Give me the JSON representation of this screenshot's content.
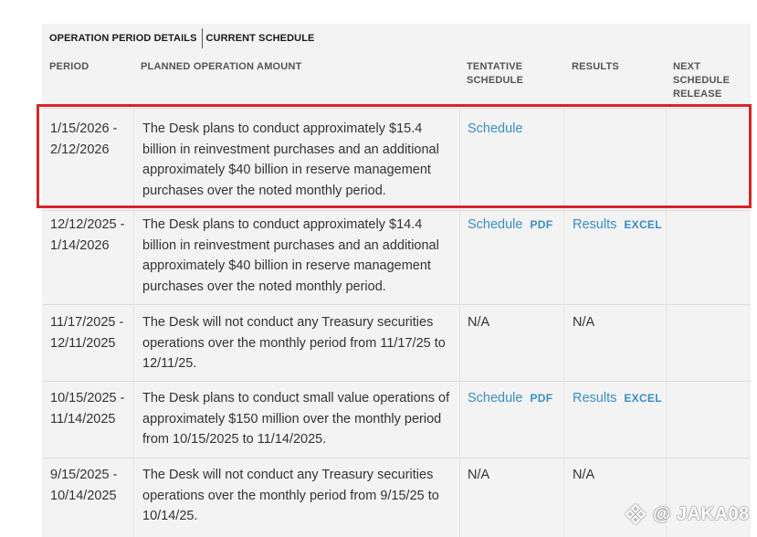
{
  "tabs": [
    {
      "label": "OPERATION PERIOD DETAILS",
      "active": true
    },
    {
      "label": "CURRENT SCHEDULE",
      "active": false
    }
  ],
  "headers": {
    "period": "PERIOD",
    "amount": "PLANNED OPERATION AMOUNT",
    "tentative_line1": "TENTATIVE",
    "tentative_line2": "SCHEDULE",
    "results": "RESULTS",
    "next_line1": "NEXT",
    "next_line2": "SCHEDULE",
    "next_line3": "RELEASE"
  },
  "rows": [
    {
      "period_start": "1/15/2026 -",
      "period_end": "2/12/2026",
      "amount": "The Desk plans to conduct approximately $15.4 billion in reinvestment purchases and an additional approximately $40 billion in reserve management purchases over the noted monthly period.",
      "schedule": "Schedule",
      "schedule_pdf": "",
      "results": "",
      "results_excel": "",
      "next": "",
      "highlighted": true
    },
    {
      "period_start": "12/12/2025 -",
      "period_end": "1/14/2026",
      "amount": "The Desk plans to conduct approximately $14.4 billion in reinvestment purchases and an additional approximately $40 billion in reserve management purchases over the noted monthly period.",
      "schedule": "Schedule",
      "schedule_pdf": "PDF",
      "results": "Results",
      "results_excel": "EXCEL",
      "next": ""
    },
    {
      "period_start": "11/17/2025 -",
      "period_end": "12/11/2025",
      "amount": "The Desk will not conduct any Treasury securities operations over the monthly period from 11/17/25 to 12/11/25.",
      "schedule": "N/A",
      "schedule_pdf": "",
      "results": "N/A",
      "results_excel": "",
      "next": ""
    },
    {
      "period_start": "10/15/2025 -",
      "period_end": "11/14/2025",
      "amount": "The Desk plans to conduct small value operations of approximately $150 million over the monthly period from 10/15/2025 to 11/14/2025.",
      "schedule": "Schedule",
      "schedule_pdf": "PDF",
      "results": "Results",
      "results_excel": "EXCEL",
      "next": ""
    },
    {
      "period_start": "9/15/2025 -",
      "period_end": "10/14/2025",
      "amount": "The Desk will not conduct any Treasury securities operations over the monthly period from 9/15/25 to 10/14/25.",
      "schedule": "N/A",
      "schedule_pdf": "",
      "results": "N/A",
      "results_excel": "",
      "next": ""
    }
  ],
  "watermark": {
    "icon": "binance-logo-icon",
    "text": "@ JAKA08"
  },
  "colors": {
    "link": "#3a8dc5",
    "highlight_border": "#d7252c",
    "panel": "#f3f3f3"
  }
}
